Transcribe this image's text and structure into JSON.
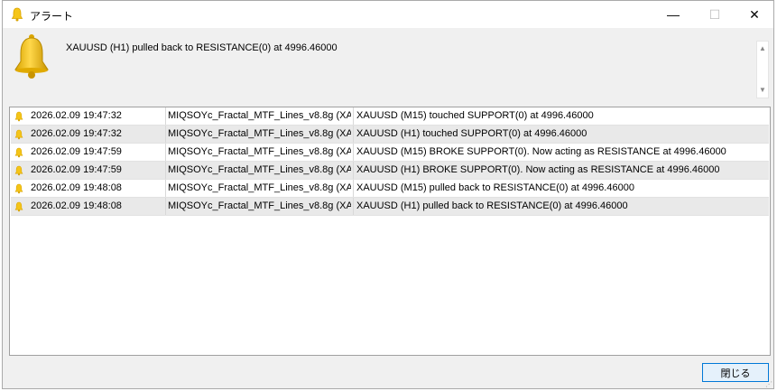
{
  "window": {
    "title": "アラート",
    "minimize_glyph": "—",
    "maximize_glyph": "☐",
    "close_glyph": "✕",
    "resize_grip": "⋰"
  },
  "message": {
    "text": "XAUUSD (H1) pulled back to RESISTANCE(0) at 4996.46000",
    "scroll_up": "▲",
    "scroll_down": "▼"
  },
  "icons": {
    "title": "bell-icon",
    "message": "bell-icon",
    "row": "bell-icon"
  },
  "colors": {
    "bell": "#f5c518",
    "bell_dark": "#d9a400",
    "button_border": "#0078d7"
  },
  "alerts": [
    {
      "time": "2026.02.09 19:47:32",
      "source": "MIQSOYc_Fractal_MTF_Lines_v8.8g (XA...",
      "message": "XAUUSD (M15) touched SUPPORT(0) at 4996.46000"
    },
    {
      "time": "2026.02.09 19:47:32",
      "source": "MIQSOYc_Fractal_MTF_Lines_v8.8g (XA...",
      "message": "XAUUSD (H1) touched SUPPORT(0) at 4996.46000"
    },
    {
      "time": "2026.02.09 19:47:59",
      "source": "MIQSOYc_Fractal_MTF_Lines_v8.8g (XA...",
      "message": "XAUUSD (M15) BROKE SUPPORT(0). Now acting as RESISTANCE at 4996.46000"
    },
    {
      "time": "2026.02.09 19:47:59",
      "source": "MIQSOYc_Fractal_MTF_Lines_v8.8g (XA...",
      "message": "XAUUSD (H1) BROKE SUPPORT(0). Now acting as RESISTANCE at 4996.46000"
    },
    {
      "time": "2026.02.09 19:48:08",
      "source": "MIQSOYc_Fractal_MTF_Lines_v8.8g (XA...",
      "message": "XAUUSD (M15) pulled back to RESISTANCE(0) at 4996.46000"
    },
    {
      "time": "2026.02.09 19:48:08",
      "source": "MIQSOYc_Fractal_MTF_Lines_v8.8g (XA...",
      "message": "XAUUSD (H1) pulled back to RESISTANCE(0) at 4996.46000"
    }
  ],
  "buttons": {
    "close_label": "閉じる"
  }
}
